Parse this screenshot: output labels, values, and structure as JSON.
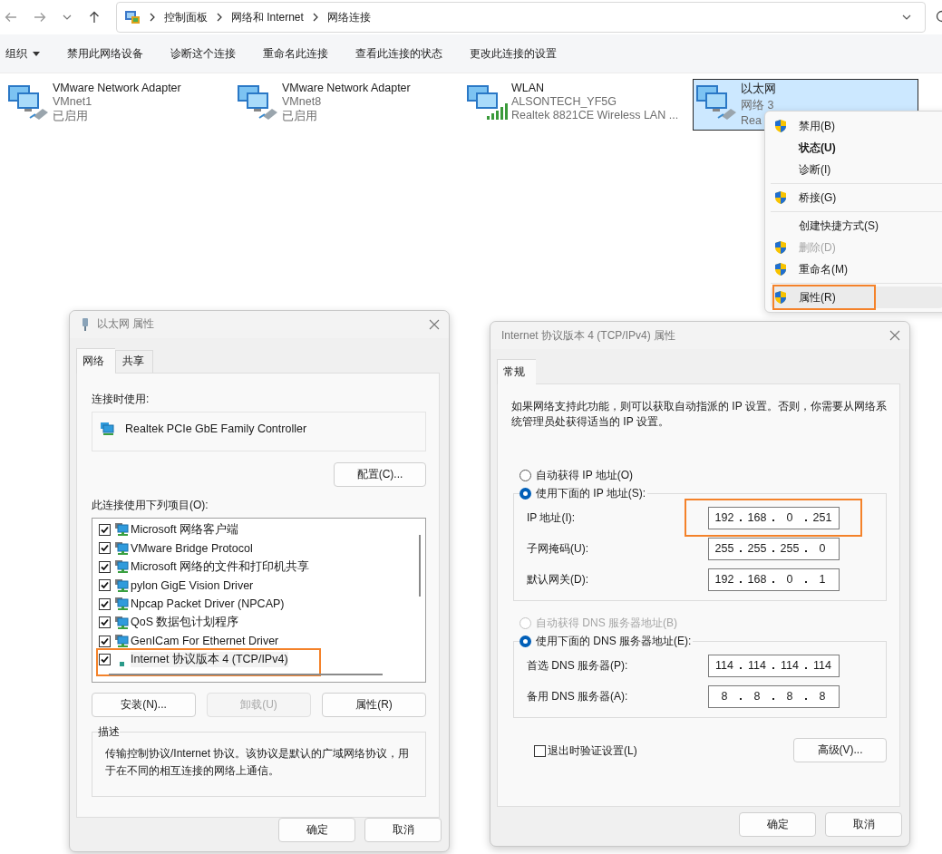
{
  "explorer": {
    "breadcrumb": [
      "控制面板",
      "网络和 Internet",
      "网络连接"
    ],
    "toolbar": [
      {
        "label": "组织",
        "dropdown": true
      },
      {
        "label": "禁用此网络设备",
        "dropdown": false
      },
      {
        "label": "诊断这个连接",
        "dropdown": false
      },
      {
        "label": "重命名此连接",
        "dropdown": false
      },
      {
        "label": "查看此连接的状态",
        "dropdown": false
      },
      {
        "label": "更改此连接的设置",
        "dropdown": false
      }
    ],
    "adapters": [
      {
        "kind": "wired",
        "name": "VMware Network Adapter",
        "network": "VMnet1",
        "status": "已启用",
        "selected": false
      },
      {
        "kind": "wired",
        "name": "VMware Network Adapter",
        "network": "VMnet8",
        "status": "已启用",
        "selected": false
      },
      {
        "kind": "wifi",
        "name": "WLAN",
        "network": "ALSONTECH_YF5G",
        "status": "Realtek 8821CE Wireless LAN ...",
        "selected": false
      },
      {
        "kind": "wired",
        "name": "以太网",
        "network": "网络 3",
        "status": "Rea",
        "selected": true
      }
    ]
  },
  "context_menu": {
    "items": [
      {
        "kind": "item",
        "label": "禁用(B)",
        "shield": true,
        "default": false,
        "disabled": false,
        "highlighted": false
      },
      {
        "kind": "item",
        "label": "状态(U)",
        "shield": false,
        "default": true,
        "disabled": false,
        "highlighted": false
      },
      {
        "kind": "item",
        "label": "诊断(I)",
        "shield": false,
        "default": false,
        "disabled": false,
        "highlighted": false
      },
      {
        "kind": "separator"
      },
      {
        "kind": "item",
        "label": "桥接(G)",
        "shield": true,
        "default": false,
        "disabled": false,
        "highlighted": false
      },
      {
        "kind": "separator"
      },
      {
        "kind": "item",
        "label": "创建快捷方式(S)",
        "shield": false,
        "default": false,
        "disabled": false,
        "highlighted": false
      },
      {
        "kind": "item",
        "label": "删除(D)",
        "shield": true,
        "default": false,
        "disabled": true,
        "highlighted": false
      },
      {
        "kind": "item",
        "label": "重命名(M)",
        "shield": true,
        "default": false,
        "disabled": false,
        "highlighted": false
      },
      {
        "kind": "separator"
      },
      {
        "kind": "item",
        "label": "属性(R)",
        "shield": true,
        "default": false,
        "disabled": false,
        "highlighted": true
      }
    ]
  },
  "ethernet_dialog": {
    "title": "以太网 属性",
    "tabs": [
      {
        "label": "网络",
        "selected": true
      },
      {
        "label": "共享",
        "selected": false
      }
    ],
    "connect_using_label": "连接时使用:",
    "adapter": "Realtek PCIe GbE Family Controller",
    "configure_button": "配置(C)...",
    "items_label": "此连接使用下列项目(O):",
    "items": [
      {
        "label": "Microsoft 网络客户端",
        "checked": true,
        "kind": "component",
        "highlighted": false
      },
      {
        "label": "VMware Bridge Protocol",
        "checked": true,
        "kind": "component",
        "highlighted": false
      },
      {
        "label": "Microsoft 网络的文件和打印机共享",
        "checked": true,
        "kind": "component",
        "highlighted": false
      },
      {
        "label": "pylon GigE Vision Driver",
        "checked": true,
        "kind": "component",
        "highlighted": false
      },
      {
        "label": "Npcap Packet Driver (NPCAP)",
        "checked": true,
        "kind": "component",
        "highlighted": false
      },
      {
        "label": "QoS 数据包计划程序",
        "checked": true,
        "kind": "component",
        "highlighted": false
      },
      {
        "label": "GenICam For Ethernet Driver",
        "checked": true,
        "kind": "component",
        "highlighted": false
      },
      {
        "label": "Internet 协议版本 4 (TCP/IPv4)",
        "checked": true,
        "kind": "protocol",
        "highlighted": true
      }
    ],
    "buttons": [
      {
        "label": "安装(N)...",
        "disabled": false
      },
      {
        "label": "卸载(U)",
        "disabled": true
      },
      {
        "label": "属性(R)",
        "disabled": false
      }
    ],
    "description_title": "描述",
    "description": "传输控制协议/Internet 协议。该协议是默认的广域网络协议，用于在不同的相互连接的网络上通信。",
    "ok": "确定",
    "cancel": "取消"
  },
  "ipv4_dialog": {
    "title": "Internet 协议版本 4 (TCP/IPv4) 属性",
    "tabs": [
      {
        "label": "常规",
        "selected": true
      }
    ],
    "intro": "如果网络支持此功能，则可以获取自动指派的 IP 设置。否则，你需要从网络系统管理员处获得适当的 IP 设置。",
    "ip_auto": {
      "label": "自动获得 IP 地址(O)",
      "selected": false,
      "disabled": false
    },
    "ip_manual": {
      "label": "使用下面的 IP 地址(S):",
      "selected": true,
      "disabled": false
    },
    "ip_fields": [
      {
        "label": "IP 地址(I):",
        "octets": [
          "192",
          "168",
          "0",
          "251"
        ],
        "highlighted": true
      },
      {
        "label": "子网掩码(U):",
        "octets": [
          "255",
          "255",
          "255",
          "0"
        ],
        "highlighted": false
      },
      {
        "label": "默认网关(D):",
        "octets": [
          "192",
          "168",
          "0",
          "1"
        ],
        "highlighted": false
      }
    ],
    "dns_auto": {
      "label": "自动获得 DNS 服务器地址(B)",
      "selected": false,
      "disabled": true
    },
    "dns_manual": {
      "label": "使用下面的 DNS 服务器地址(E):",
      "selected": true,
      "disabled": false
    },
    "dns_fields": [
      {
        "label": "首选 DNS 服务器(P):",
        "octets": [
          "114",
          "114",
          "114",
          "114"
        ],
        "highlighted": false
      },
      {
        "label": "备用 DNS 服务器(A):",
        "octets": [
          "8",
          "8",
          "8",
          "8"
        ],
        "highlighted": false
      }
    ],
    "validate": {
      "label": "退出时验证设置(L)",
      "checked": false
    },
    "advanced_button": "高级(V)...",
    "ok": "确定",
    "cancel": "取消"
  }
}
